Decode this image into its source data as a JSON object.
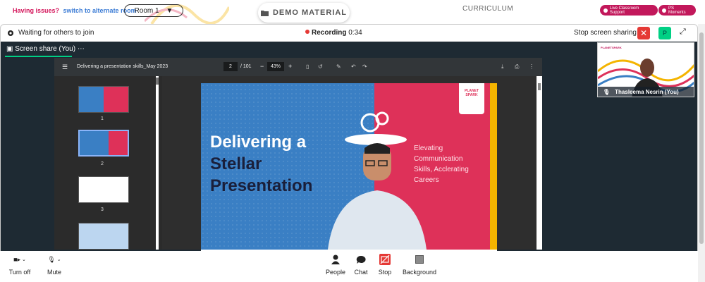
{
  "topbar": {
    "issue_text": "Having issues?",
    "alt_room_link": "switch to alternate room",
    "room": "Room 1",
    "demo_material": "DEMO MATERIAL",
    "curriculum": "CURRICULUM",
    "live_support": "Live Classroom Support",
    "ps_moments": "PS Moments"
  },
  "header": {
    "waiting": "Waiting for others to join",
    "recording_label": "Recording",
    "recording_time": "0:34",
    "stop_sharing": "Stop screen sharing",
    "p_button": "P"
  },
  "screen_tab": {
    "label": "Screen share (You)",
    "menu": "⋯"
  },
  "pdf": {
    "file_name": "Delivering a presentation skills_May 2023",
    "page": "2",
    "total": "/ 101",
    "zoom": "43%",
    "thumb_numbers": [
      "1",
      "2",
      "3"
    ]
  },
  "slide": {
    "title_line1": "Delivering a",
    "title_line2": "Stellar",
    "title_line3": "Presentation",
    "sub_line1": "Elevating",
    "sub_line2": "Communication",
    "sub_line3": "Skills, Acclerating",
    "sub_line4": "Careers",
    "logo_line1": "PLANET",
    "logo_line2": "SPARK"
  },
  "camera": {
    "brand": "PLANETSPARK",
    "name": "Thasleema Nesrin (You)"
  },
  "bottom": {
    "turn_off": "Turn off",
    "mute": "Mute",
    "people": "People",
    "chat": "Chat",
    "stop": "Stop",
    "background": "Background"
  },
  "colors": {
    "accent_pink": "#c2185b",
    "recording_red": "#e53935",
    "green": "#00d084",
    "stage_dark": "#1e2a33",
    "slide_blue": "#3a7fc4",
    "slide_pink": "#de3159",
    "slide_yellow": "#f4b400"
  }
}
